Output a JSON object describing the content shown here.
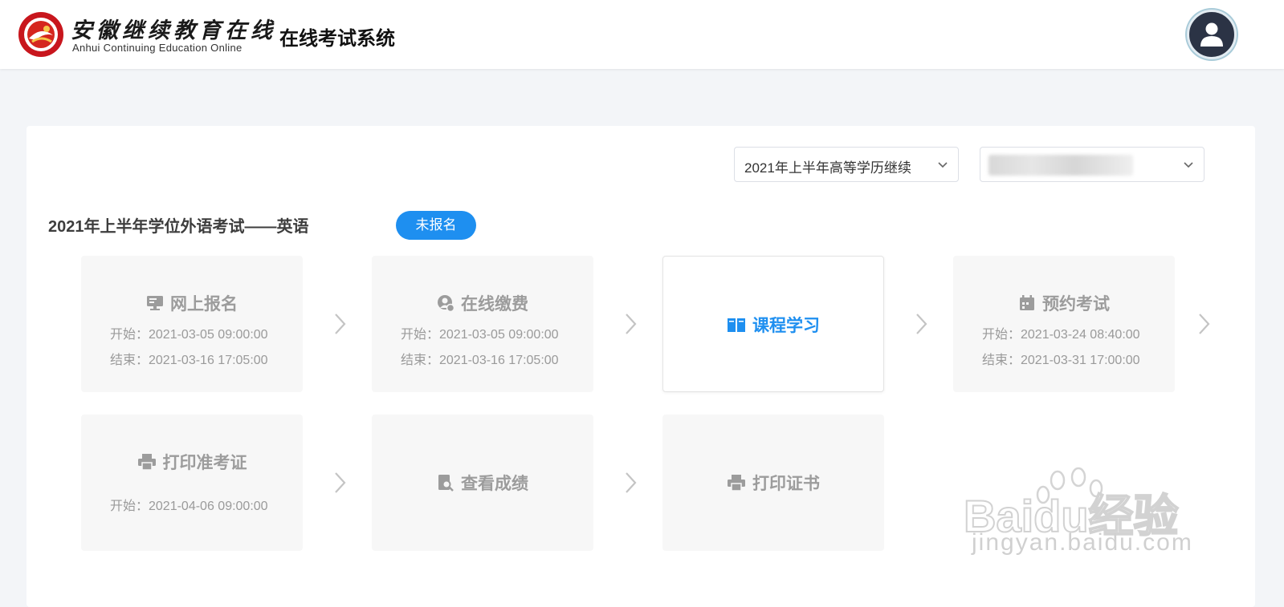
{
  "header": {
    "logo_cn": "安徽继续教育在线",
    "logo_en": "Anhui Continuing Education  Online",
    "app_title": "在线考试系统",
    "avatar_icon": "user-icon"
  },
  "filters": {
    "term_value": "2021年上半年高等学历继续",
    "second_value": ""
  },
  "exam": {
    "title": "2021年上半年学位外语考试——英语",
    "status": "未报名",
    "status_color": "#1e8ff0"
  },
  "steps": [
    {
      "label": "网上报名",
      "icon": "monitor-icon",
      "start": "开始：2021-03-05 09:00:00",
      "end": "结束：2021-03-16 17:05:00",
      "active": false
    },
    {
      "label": "在线缴费",
      "icon": "user-coin-icon",
      "start": "开始：2021-03-05 09:00:00",
      "end": "结束：2021-03-16 17:05:00",
      "active": false
    },
    {
      "label": "课程学习",
      "icon": "book-icon",
      "start": "",
      "end": "",
      "active": true
    },
    {
      "label": "预约考试",
      "icon": "calendar-icon",
      "start": "开始：2021-03-24 08:40:00",
      "end": "结束：2021-03-31 17:00:00",
      "active": false
    },
    {
      "label": "打印准考证",
      "icon": "printer-icon",
      "start": "开始：2021-04-06 09:00:00",
      "end": "",
      "active": false
    },
    {
      "label": "查看成绩",
      "icon": "document-search-icon",
      "start": "",
      "end": "",
      "active": false
    },
    {
      "label": "打印证书",
      "icon": "printer-icon",
      "start": "",
      "end": "",
      "active": false
    }
  ],
  "watermark": {
    "brand": "Baidu经验",
    "url": "jingyan.baidu.com"
  }
}
